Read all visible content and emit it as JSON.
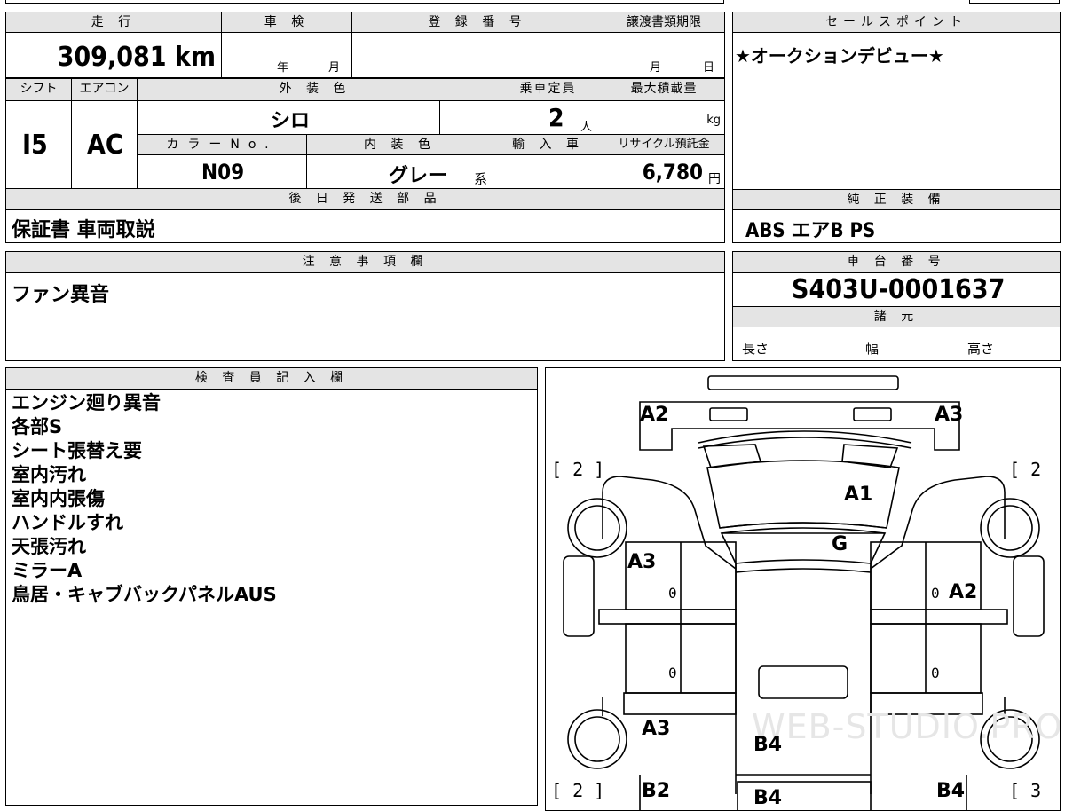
{
  "top": {
    "mileage_header": "走 行",
    "mileage_value": "309,081 km",
    "inspection_header": "車 検",
    "inspection_year": "年",
    "inspection_month": "月",
    "regno_header": "登 録 番 号",
    "transfer_header": "譲渡書類期限",
    "transfer_month": "月",
    "transfer_day": "日",
    "sales_header": "セールスポイント",
    "sales_text": "★オークションデビュー★"
  },
  "row2": {
    "shift_header": "シフト",
    "shift_value": "I5",
    "ac_header": "エアコン",
    "ac_value": "AC",
    "ext_color_header": "外 装 色",
    "ext_color_value": "シロ",
    "capacity_header": "乗車定員",
    "capacity_value": "2",
    "capacity_unit": "人",
    "maxload_header": "最大積載量",
    "maxload_unit": "kg",
    "color_no_header": "カラーNo.",
    "color_no_value": "N09",
    "int_color_header": "内 装 色",
    "int_color_value": "グレー",
    "int_color_suffix": "系",
    "import_header": "輸 入 車",
    "recycle_header": "リサイクル預託金",
    "recycle_value": "6,780",
    "recycle_unit": "円"
  },
  "later_parts": {
    "header": "後 日 発 送 部 品",
    "value": "保証書 車両取説"
  },
  "genuine": {
    "header": "純 正 装 備",
    "value": "ABS エアB PS"
  },
  "caution": {
    "header": "注 意 事 項 欄",
    "value": "ファン異音"
  },
  "chassis": {
    "header": "車 台 番 号",
    "value": "S403U-0001637",
    "spec_header": "諸 元",
    "length": "長さ",
    "width": "幅",
    "height": "高さ"
  },
  "inspector": {
    "header": "検 査 員 記 入 欄",
    "lines": [
      "エンジン廻り異音",
      "各部S",
      "シート張替え要",
      "室内汚れ",
      "室内内張傷",
      "ハンドルすれ",
      "天張汚れ",
      "ミラーA",
      "鳥居・キャブバックパネルAUS"
    ]
  },
  "diagram": {
    "labels": {
      "a2_top_left": "A2",
      "a3_top_right": "A3",
      "a1_roof": "A1",
      "g_glass": "G",
      "a3_left_door": "A3",
      "a2_right_door": "A2",
      "a3_left_rear": "A3",
      "b4_bed": "B4",
      "b4_bed2": "B4",
      "b2_left": "B2",
      "b4_right": "B4",
      "bracket_2_left": "[ 2 ]",
      "bracket_2_right": "[ 2",
      "bracket_2_left_low": "[ 2 ]",
      "bracket_3_right_low": "[ 3",
      "zero1": "0",
      "zero2": "0",
      "zero3": "0",
      "zero4": "0"
    },
    "watermark": "WEB-STUDIO.PRO"
  }
}
